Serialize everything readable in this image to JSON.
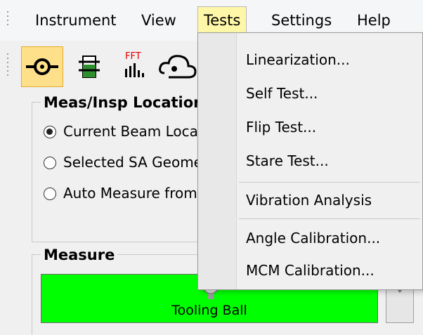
{
  "menubar": {
    "items": [
      {
        "label": "Instrument"
      },
      {
        "label": "View"
      },
      {
        "label": "Tests",
        "active": true
      },
      {
        "label": "Settings"
      },
      {
        "label": "Help"
      }
    ]
  },
  "toolbar": {
    "buttons": [
      {
        "icon": "laser-target-icon",
        "selected": true
      },
      {
        "icon": "level-icon"
      },
      {
        "icon": "fft-icon",
        "text": "FFT"
      },
      {
        "icon": "cloud-icon"
      }
    ]
  },
  "location_group": {
    "title": "Meas/Insp Location",
    "options": [
      {
        "label": "Current Beam Location",
        "checked": true
      },
      {
        "label": "Selected SA Geometry",
        "checked": false
      },
      {
        "label": "Auto Measure from File",
        "checked": false
      }
    ]
  },
  "measure_group": {
    "title": "Measure",
    "button_label": "Tooling Ball",
    "button_color": "#00ff00"
  },
  "tests_menu": {
    "items": [
      {
        "label": "Linearization..."
      },
      {
        "label": "Self Test..."
      },
      {
        "label": "Flip Test..."
      },
      {
        "label": "Stare Test..."
      },
      {
        "label": "Vibration Analysis"
      },
      {
        "label": "Angle Calibration..."
      },
      {
        "label": "MCM Calibration..."
      }
    ]
  },
  "colors": {
    "active_menu": "#fff7a8",
    "selected_tool": "#ffe08a",
    "fft_red": "#e00000"
  }
}
